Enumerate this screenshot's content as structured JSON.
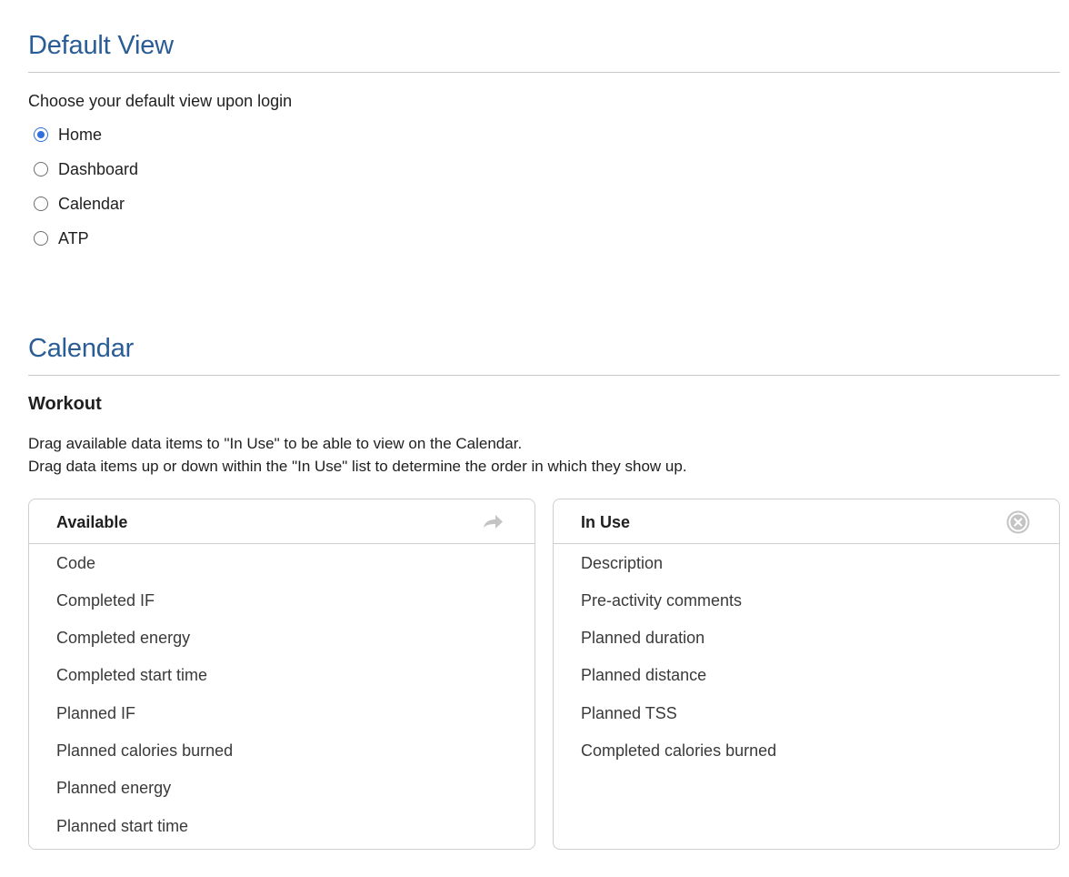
{
  "default_view": {
    "title": "Default View",
    "prompt": "Choose your default view upon login",
    "options": [
      {
        "label": "Home",
        "checked": true
      },
      {
        "label": "Dashboard",
        "checked": false
      },
      {
        "label": "Calendar",
        "checked": false
      },
      {
        "label": "ATP",
        "checked": false
      }
    ]
  },
  "calendar": {
    "title": "Calendar",
    "workout": {
      "heading": "Workout",
      "help": [
        "Drag available data items to \"In Use\" to be able to view on the Calendar.",
        "Drag data items up or down within the \"In Use\" list to determine the order in which they show up."
      ],
      "available": {
        "title": "Available",
        "icon": "forward-arrow-icon",
        "items": [
          "Code",
          "Completed IF",
          "Completed energy",
          "Completed start time",
          "Planned IF",
          "Planned calories burned",
          "Planned energy",
          "Planned start time"
        ]
      },
      "in_use": {
        "title": "In Use",
        "icon": "clear-circle-icon",
        "items": [
          "Description",
          "Pre-activity comments",
          "Planned duration",
          "Planned distance",
          "Planned TSS",
          "Completed calories burned"
        ]
      }
    }
  }
}
